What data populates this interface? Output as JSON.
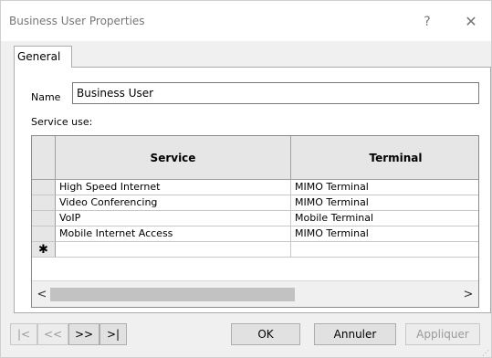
{
  "window": {
    "title": "Business User Properties",
    "help_label": "?",
    "close_label": "✕"
  },
  "tabs": [
    {
      "label": "General"
    }
  ],
  "form": {
    "name_label": "Name",
    "name_value": "Business User",
    "service_use_label": "Service use:"
  },
  "grid": {
    "columns": [
      "Service",
      "Terminal"
    ],
    "rows": [
      {
        "service": "High Speed Internet",
        "terminal": "MIMO Terminal"
      },
      {
        "service": "Video Conferencing",
        "terminal": "MIMO Terminal"
      },
      {
        "service": "VoIP",
        "terminal": "Mobile Terminal"
      },
      {
        "service": "Mobile Internet Access",
        "terminal": "MIMO Terminal"
      }
    ],
    "new_row_marker": "✱",
    "scroll_left": "<",
    "scroll_right": ">"
  },
  "navigation": {
    "first": "|<",
    "prev": "<<",
    "next": ">>",
    "last": ">|"
  },
  "buttons": {
    "ok": "OK",
    "cancel": "Annuler",
    "apply": "Appliquer"
  }
}
